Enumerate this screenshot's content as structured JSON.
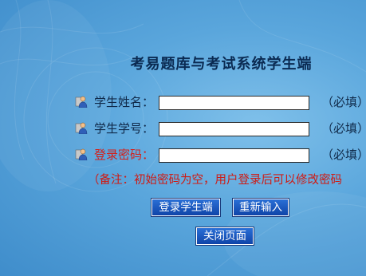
{
  "title": "考易题库与考试系统学生端",
  "form": {
    "name": {
      "label": "学生姓名：",
      "value": "",
      "required": "（必填）",
      "icon": "user-icon"
    },
    "id": {
      "label": "学生学号：",
      "value": "",
      "required": "（必填）",
      "icon": "user-icon"
    },
    "password": {
      "label": "登录密码：",
      "value": "",
      "required": "（必填）",
      "icon": "user-icon",
      "label_color": "#d4201a"
    }
  },
  "note": "（备注：初始密码为空，用户登录后可以修改密码",
  "buttons": {
    "login": "登录学生端",
    "reset": "重新输入",
    "close": "关闭页面"
  },
  "colors": {
    "background": "#5aa6dc",
    "button": "#1a55c0",
    "warning_text": "#cf1a13"
  }
}
